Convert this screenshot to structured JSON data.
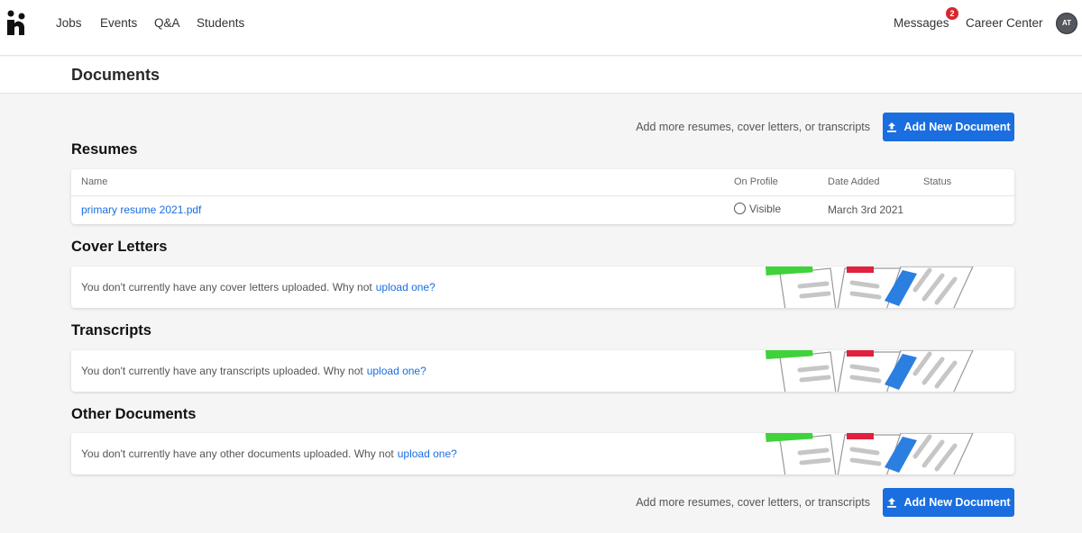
{
  "nav": {
    "links": [
      "Jobs",
      "Events",
      "Q&A",
      "Students"
    ],
    "messages_label": "Messages",
    "messages_count": "2",
    "career_center_label": "Career Center",
    "avatar_initials": "AT"
  },
  "page": {
    "title": "Documents"
  },
  "add_action": {
    "hint": "Add more resumes, cover letters, or transcripts",
    "button_label": "Add New Document"
  },
  "resumes": {
    "title": "Resumes",
    "columns": [
      "Name",
      "On Profile",
      "Date Added",
      "Status"
    ],
    "rows": [
      {
        "name": "primary resume 2021.pdf",
        "on_profile": "Visible",
        "date_added": "March 3rd 2021",
        "status": ""
      }
    ]
  },
  "cover_letters": {
    "title": "Cover Letters",
    "empty_text": "You don't currently have any cover letters uploaded. Why not",
    "link": "upload one?"
  },
  "transcripts": {
    "title": "Transcripts",
    "empty_text": "You don't currently have any transcripts uploaded. Why not",
    "link": "upload one?"
  },
  "other_documents": {
    "title": "Other Documents",
    "empty_text": "You don't currently have any other documents uploaded. Why not",
    "link": "upload one?"
  },
  "colors": {
    "accent": "#1a6ee0",
    "badge": "#d9262c",
    "illus_green": "#3fd23a",
    "illus_red": "#e0213f",
    "illus_blue": "#2a7fe0"
  }
}
